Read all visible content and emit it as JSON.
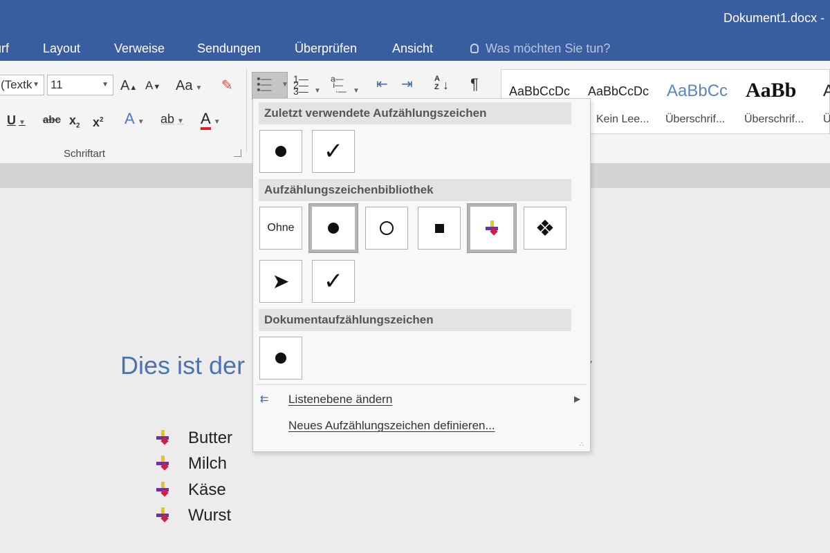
{
  "window": {
    "title": "Dokument1.docx -"
  },
  "tabs": [
    {
      "label": "urf"
    },
    {
      "label": "Layout"
    },
    {
      "label": "Verweise"
    },
    {
      "label": "Sendungen"
    },
    {
      "label": "Überprüfen"
    },
    {
      "label": "Ansicht"
    }
  ],
  "tellme": {
    "text": "Was möchten Sie tun?"
  },
  "font": {
    "name": "(Textk",
    "size": "11"
  },
  "ribbon": {
    "grow": "A",
    "shrink": "A",
    "case": "Aa",
    "underline": "U",
    "strike": "abc",
    "sub": "x",
    "sub_mark": "2",
    "sup": "x",
    "sup_mark": "2",
    "effects": "A",
    "highlight": "ab",
    "font_color": "A",
    "pilcrow": "¶",
    "sort": "A Z",
    "group_label": "Schriftart"
  },
  "styles": [
    {
      "preview": "AaBbCcDc",
      "name": ""
    },
    {
      "preview": "AaBbCcDc",
      "name": "Kein Lee..."
    },
    {
      "preview": "AaBbCc",
      "name": "Überschrif..."
    },
    {
      "preview": "AaBb",
      "name": "Überschrif..."
    },
    {
      "preview": "A",
      "name": "Ü"
    }
  ],
  "dropdown": {
    "recent_header": "Zuletzt verwendete Aufzählungszeichen",
    "library_header": "Aufzählungszeichenbibliothek",
    "document_header": "Dokumentaufzählungszeichen",
    "none_label": "Ohne",
    "check": "✓",
    "diamond": "❖",
    "arrow": "➤",
    "change_level": "Listenebene ändern",
    "define_new": "Neues Aufzählungszeichen definieren..."
  },
  "document": {
    "heading": "Dies ist der",
    "heading_tail": "y",
    "items": [
      "Butter",
      "Milch",
      "Käse",
      "Wurst"
    ]
  }
}
